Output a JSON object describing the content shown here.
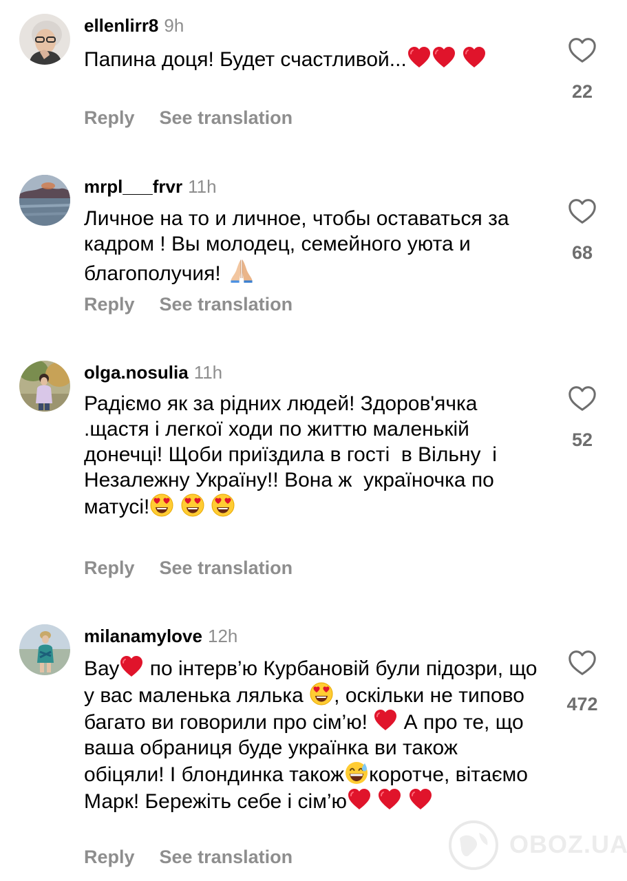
{
  "comments": [
    {
      "username": "ellenlirr8",
      "time": "9h",
      "text_parts": [
        "Папина доця! Будет счастливой..."
      ],
      "likes": "22",
      "reply": "Reply",
      "translate": "See translation"
    },
    {
      "username": "mrpl___frvr",
      "time": "11h",
      "text_parts": [
        "Личное на то и личное, чтобы оставаться за кадром ! Вы молодец, семейного уюта и благополучия! "
      ],
      "likes": "68",
      "reply": "Reply",
      "translate": "See translation"
    },
    {
      "username": "olga.nosulia",
      "time": "11h",
      "text_parts": [
        "Радіємо як за рідних людей! Здоров'ячка .щастя і легкої ходи по життю маленькій донечці! Щоби приїздила в гості  в Вільну  і Незалежну Україну!! Вона ж  україночка по матусі!"
      ],
      "likes": "52",
      "reply": "Reply",
      "translate": "See translation"
    },
    {
      "username": "milanamylove",
      "time": "12h",
      "text_parts": [
        "Вау",
        " по інтерв’ю Курбановій були підозри, що у вас маленька лялька ",
        ", оскільки не типово багато ви говорили про сім’ю! ",
        " А про те, що ваша обраниця буде українка ви також обіцяли! І блондинка також",
        "коротче, вітаємо Марк! Бережіть себе і сім’ю"
      ],
      "likes": "472",
      "reply": "Reply",
      "translate": "See translation"
    }
  ],
  "watermark": "OBOZ.UA",
  "icons": {
    "like": "heart-outline-icon",
    "heart_emoji": "red-heart-emoji",
    "heart_eyes_emoji": "heart-eyes-emoji",
    "pray_emoji": "folded-hands-emoji",
    "sweat_emoji": "grinning-sweat-emoji"
  },
  "colors": {
    "text": "#000000",
    "secondary": "#8e8e8e",
    "like_count": "#6e6e6e",
    "heart": "#e0142b"
  }
}
